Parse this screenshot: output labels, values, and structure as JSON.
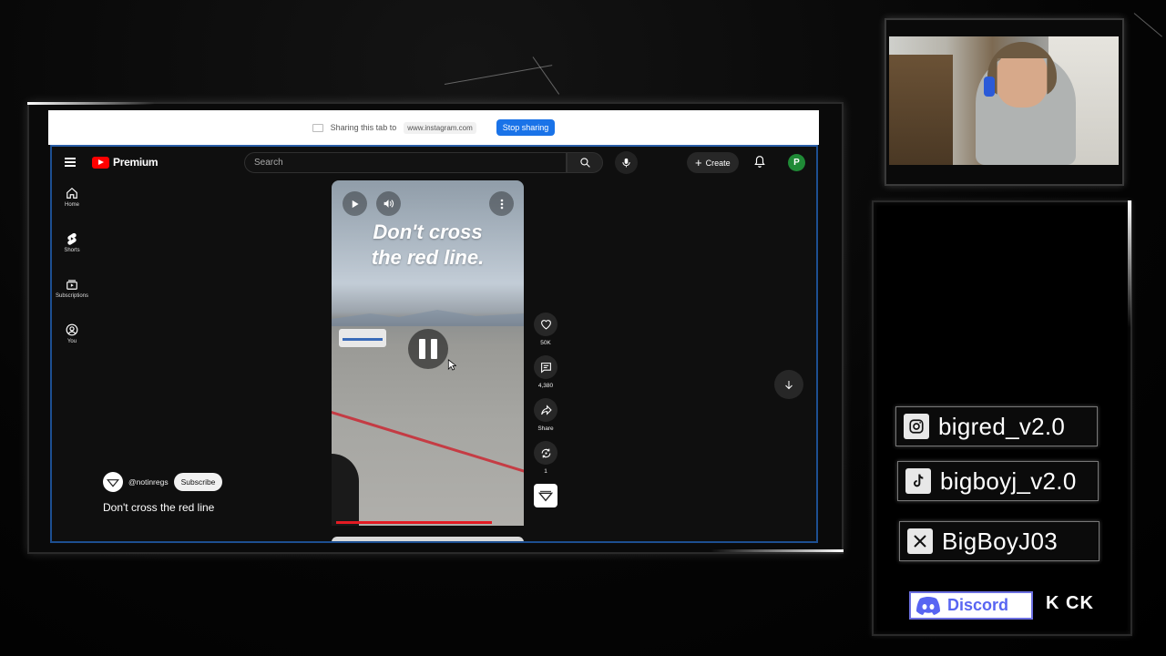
{
  "share_bar": {
    "text": "Sharing this tab to",
    "url": "www.instagram.com",
    "stop_label": "Stop sharing"
  },
  "youtube": {
    "brand": "Premium",
    "search_placeholder": "Search",
    "create_label": "Create",
    "avatar_letter": "P",
    "sidebar": [
      {
        "label": "Home",
        "icon": "home-icon"
      },
      {
        "label": "Shorts",
        "icon": "shorts-icon"
      },
      {
        "label": "Subscriptions",
        "icon": "subscriptions-icon"
      },
      {
        "label": "You",
        "icon": "you-icon"
      }
    ],
    "video": {
      "overlay_line1": "Don't cross",
      "overlay_line2": "the red line.",
      "progress": 0.81
    },
    "actions": {
      "likes": "50K",
      "comments": "4,380",
      "share_label": "Share",
      "remix_count": "1"
    },
    "channel": {
      "handle": "@notinregs",
      "subscribe_label": "Subscribe"
    },
    "video_title": "Don't cross the red line"
  },
  "socials": {
    "instagram": "bigred_v2.0",
    "tiktok": "bigboyj_v2.0",
    "x": "BigBoyJ03",
    "discord_label": "Discord",
    "kick_label": "K CK"
  },
  "colors": {
    "youtube_red": "#ff0000",
    "accent_blue": "#1a73e8",
    "discord_blurple": "#5865f2",
    "avatar_green": "#1f8a36"
  }
}
